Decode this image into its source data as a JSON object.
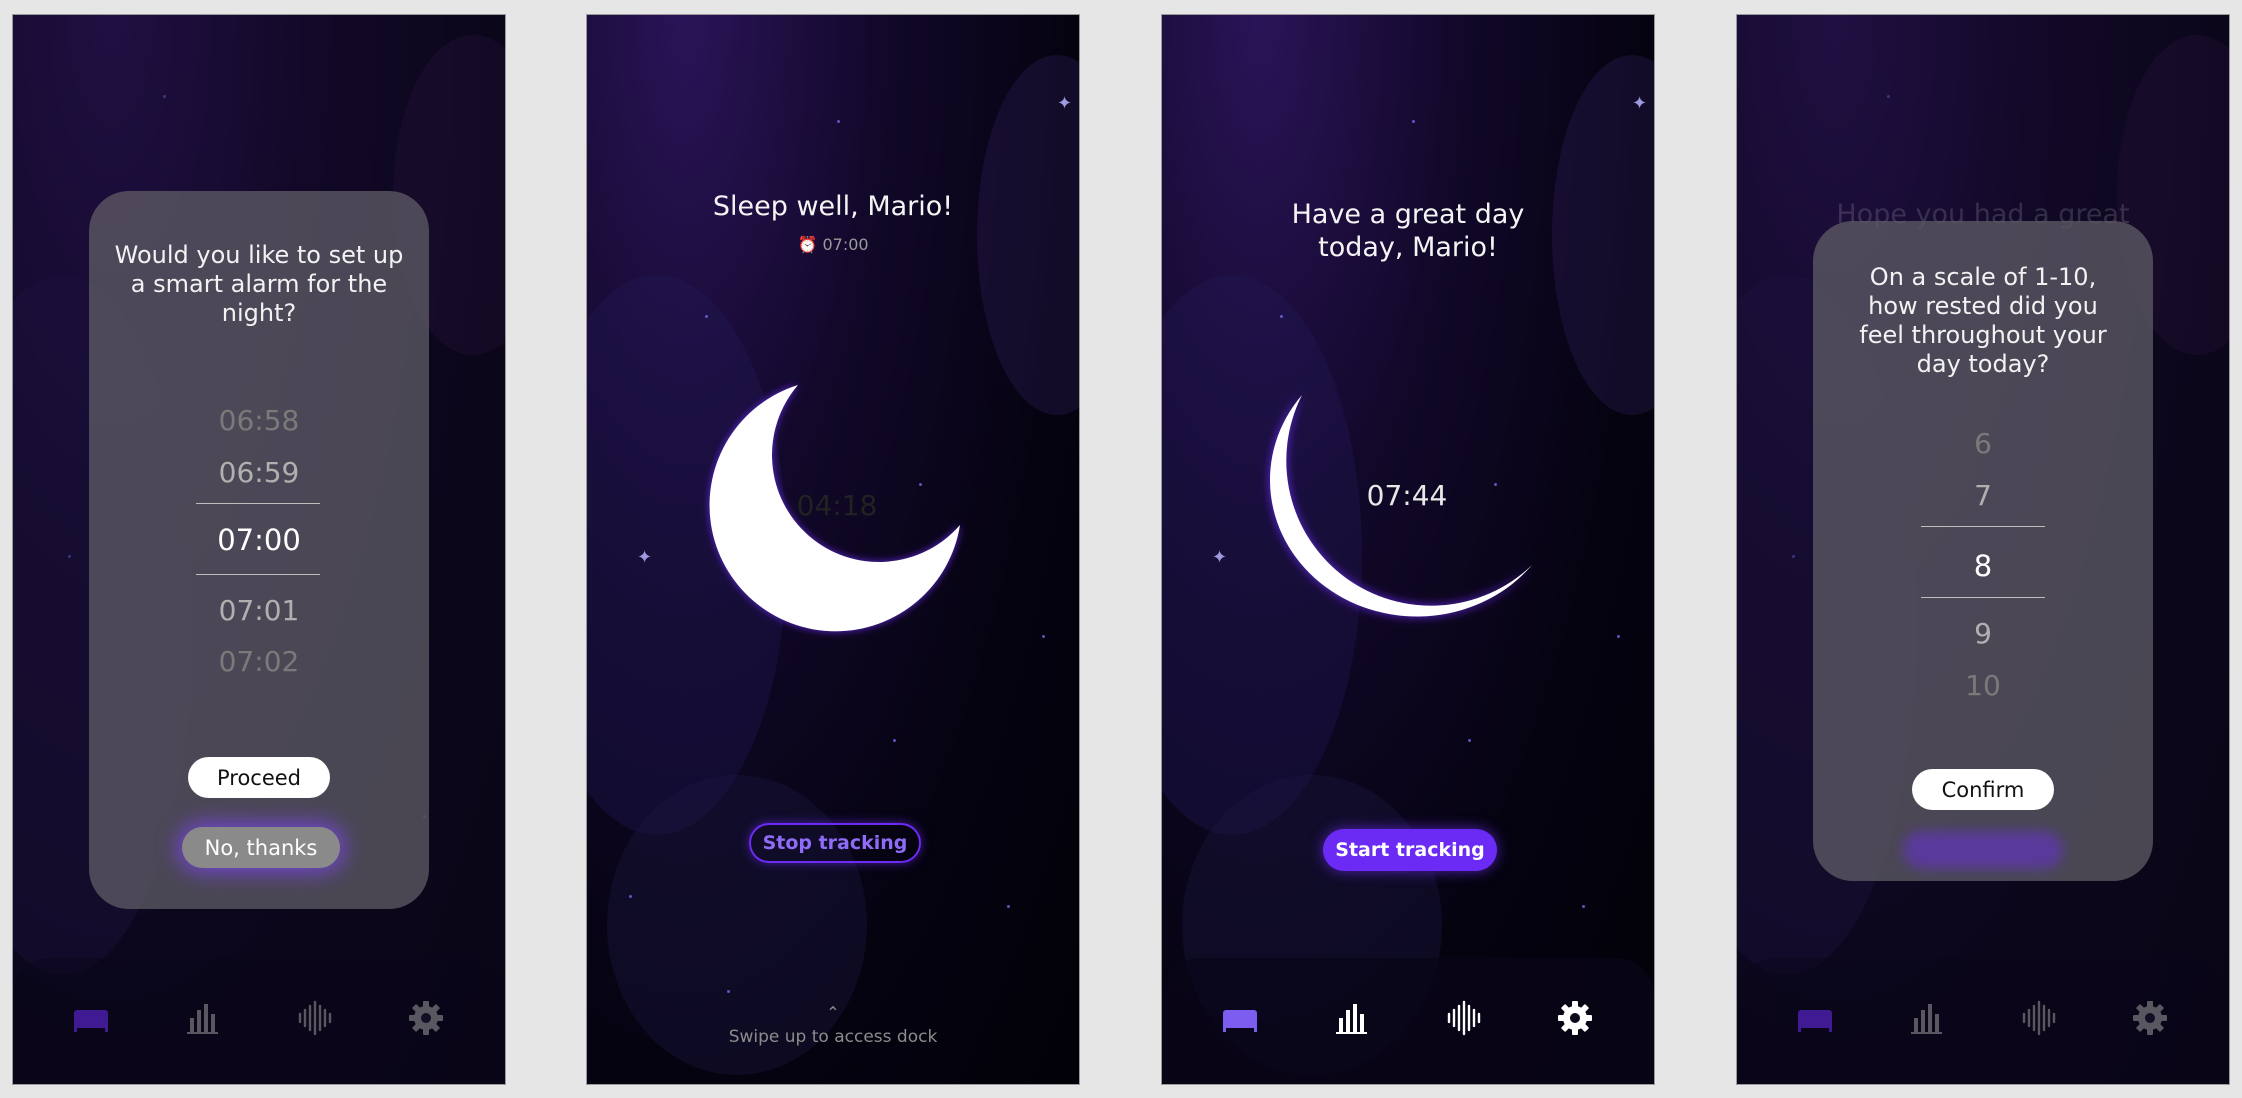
{
  "screen1": {
    "question": "Would you like to set up a smart alarm for the night?",
    "times": [
      "06:58",
      "06:59",
      "07:00",
      "07:01",
      "07:02"
    ],
    "proceed_label": "Proceed",
    "decline_label": "No, thanks"
  },
  "screen2": {
    "greeting": "Sleep well, Mario!",
    "alarm_time": "07:00",
    "elapsed": "04:18",
    "stop_label": "Stop tracking",
    "swipe_hint": "Swipe up to access dock"
  },
  "screen3": {
    "greeting": "Have a great day today, Mario!",
    "time": "07:44",
    "start_label": "Start tracking"
  },
  "screen4": {
    "background_heading": "Hope you had a great",
    "question": "On a scale of 1-10, how rested did you feel throughout your day today?",
    "ratings": [
      "6",
      "7",
      "8",
      "9",
      "10"
    ],
    "confirm_label": "Confirm"
  },
  "dock": {
    "items": [
      "bed-icon",
      "stats-icon",
      "sound-wave-icon",
      "settings-icon"
    ]
  },
  "colors": {
    "accent": "#6c2bf5",
    "accent_light": "#7d5cf0",
    "background": "#05030f"
  }
}
